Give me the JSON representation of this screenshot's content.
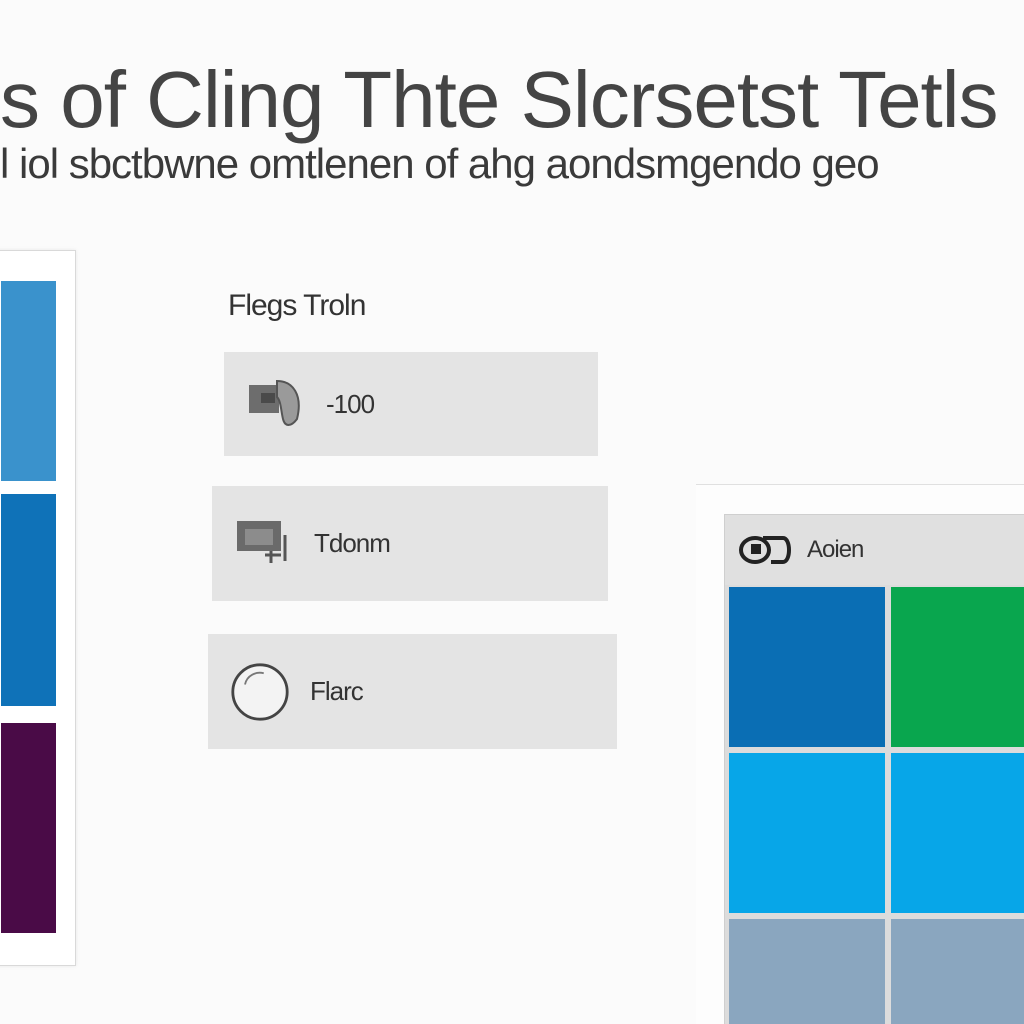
{
  "header": {
    "title": "s of Cling Thte Slcrsetst Tetls",
    "subtitle": "l iol sbctbwne omtlenen of ahg aondsmgendo geo"
  },
  "left_panel": {
    "swatches": [
      {
        "color": "#3a92cc"
      },
      {
        "color": "#0f72b8"
      },
      {
        "color": "#4a0b47"
      }
    ]
  },
  "list": {
    "heading": "Flegs Troln",
    "items": [
      {
        "label": "-100",
        "icon": "folder-icon"
      },
      {
        "label": "Tdonm",
        "icon": "device-icon"
      },
      {
        "label": "Flarc",
        "icon": "circle-icon"
      }
    ]
  },
  "tile_panel": {
    "header_label": "Aoien",
    "header_icon": "app-logo-icon",
    "tiles": [
      {
        "color": "#0a6eb4"
      },
      {
        "color": "#09a64e"
      },
      {
        "color": "#07a6e8"
      },
      {
        "color": "#07a6e8"
      },
      {
        "color": "#8aa6bf"
      },
      {
        "color": "#8aa6bf"
      }
    ]
  }
}
